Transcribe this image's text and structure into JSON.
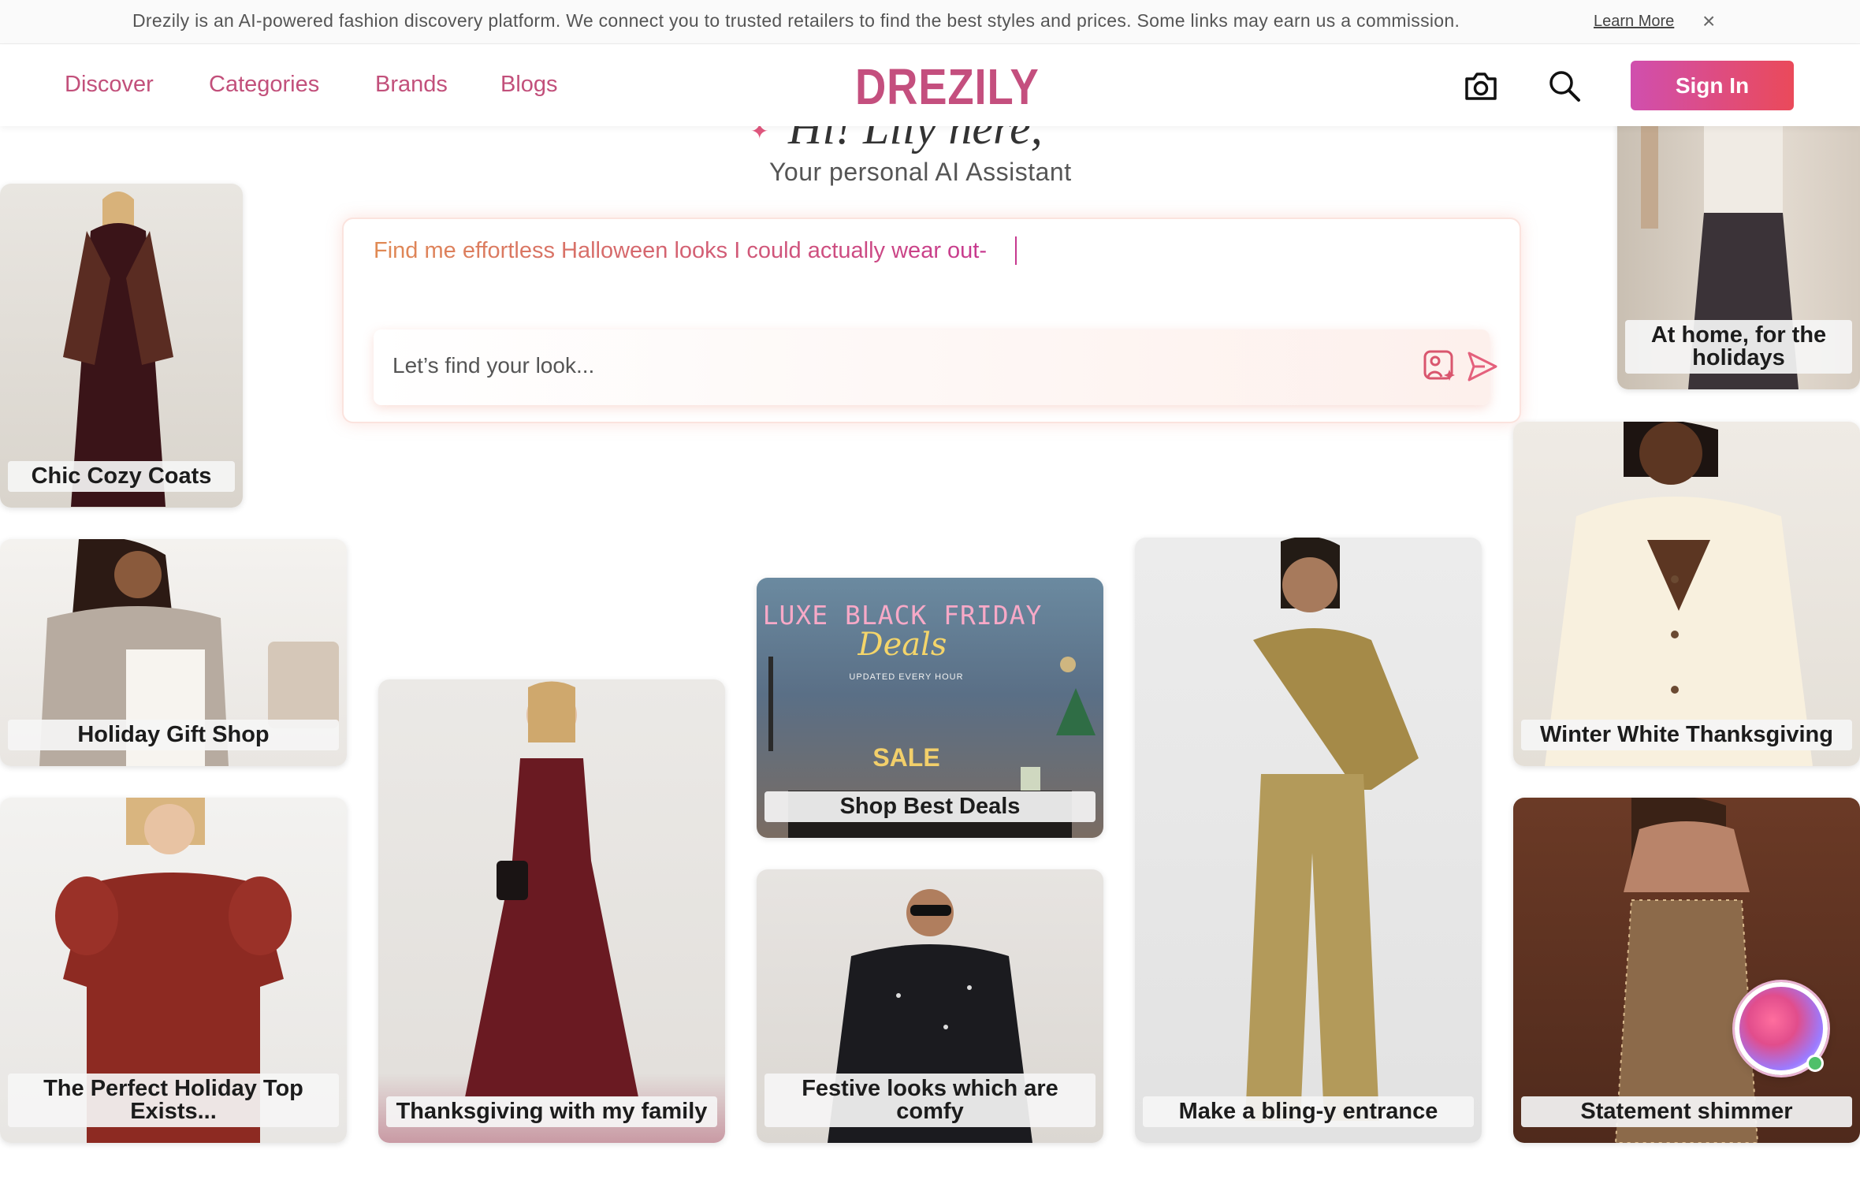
{
  "announcement": {
    "text": "Drezily is an AI-powered fashion discovery platform. We connect you to trusted retailers to find the best styles and prices. Some links may earn us a commission.",
    "learn_more": "Learn More",
    "close_glyph": "×"
  },
  "header": {
    "nav": [
      "Discover",
      "Categories",
      "Brands",
      "Blogs"
    ],
    "logo": "DREZILY",
    "sign_in": "Sign In",
    "icons": [
      "camera-icon",
      "search-icon"
    ]
  },
  "hero": {
    "greeting": "Hi! Lily here,",
    "subtitle": "Your personal AI Assistant",
    "prompt": "Find me effortless Halloween looks I could actually wear out-",
    "placeholder": "Let’s find your look...",
    "icons": [
      "image-search-icon",
      "send-icon"
    ]
  },
  "cards": [
    {
      "label": "Chic Cozy Coats"
    },
    {
      "label": "At home, for the holidays"
    },
    {
      "label": "Holiday Gift Shop"
    },
    {
      "label": "Winter White Thanksgiving"
    },
    {
      "label": "Shop Best Deals",
      "promo_title": "LUXE BLACK FRIDAY",
      "promo_script": "Deals",
      "promo_sub": "UPDATED EVERY HOUR",
      "promo_sale": "SALE"
    },
    {
      "label": "The Perfect Holiday Top Exists..."
    },
    {
      "label": "Thanksgiving with my family"
    },
    {
      "label": "Festive looks which are comfy"
    },
    {
      "label": "Make a bling-y entrance"
    },
    {
      "label": "Statement shimmer"
    }
  ],
  "colors": {
    "brand": "#c44f7e",
    "nav": "#c2507b",
    "signin_start": "#d04fae",
    "signin_end": "#ea4a5a"
  }
}
